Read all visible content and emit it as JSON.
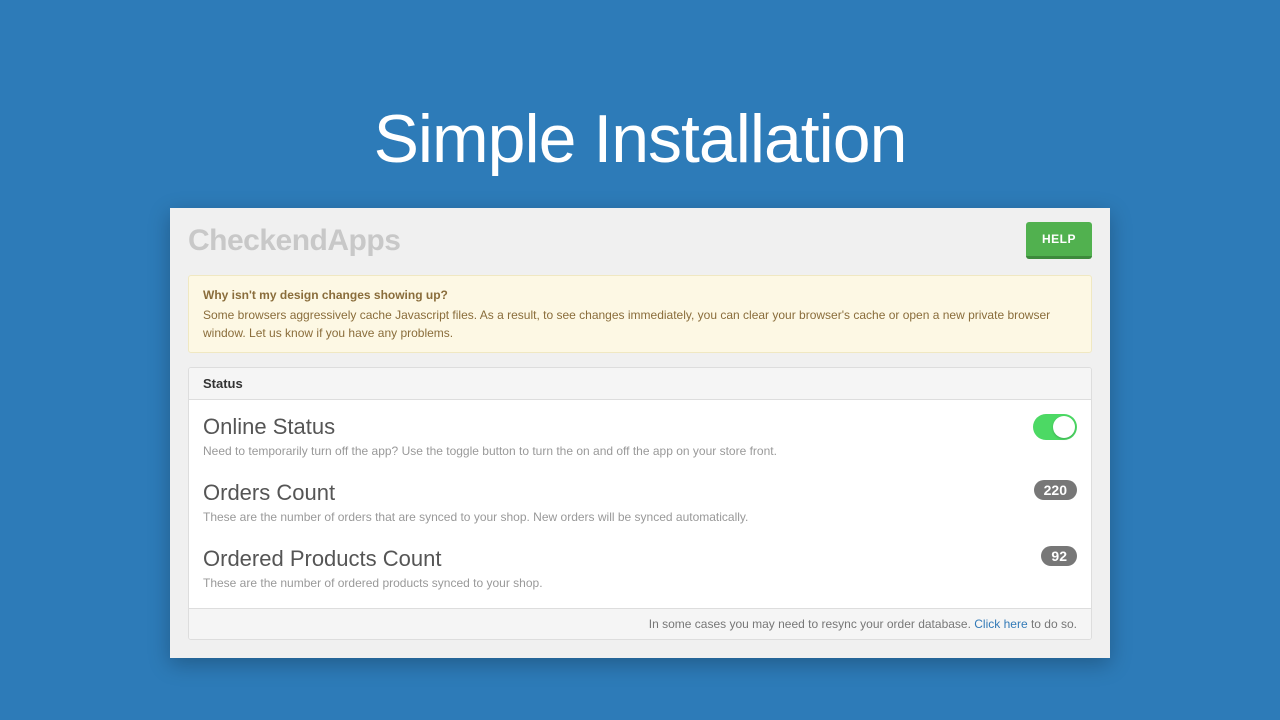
{
  "hero": {
    "title": "Simple Installation"
  },
  "header": {
    "brand": "CheckendApps",
    "help_label": "HELP"
  },
  "alert": {
    "title": "Why isn't my design changes showing up?",
    "body": "Some browsers aggressively cache Javascript files. As a result, to see changes immediately, you can clear your browser's cache or open a new private browser window. Let us know if you have any problems."
  },
  "status_card": {
    "header": "Status",
    "rows": {
      "online": {
        "title": "Online Status",
        "desc": "Need to temporarily turn off the app? Use the toggle button to turn the on and off the app on your store front.",
        "toggle_on": true
      },
      "orders": {
        "title": "Orders Count",
        "desc": "These are the number of orders that are synced to your shop. New orders will be synced automatically.",
        "count": "220"
      },
      "products": {
        "title": "Ordered Products Count",
        "desc": "These are the number of ordered products synced to your shop.",
        "count": "92"
      }
    },
    "footer": {
      "prefix": "In some cases you may need to resync your order database. ",
      "link": "Click here",
      "suffix": " to do so."
    }
  }
}
